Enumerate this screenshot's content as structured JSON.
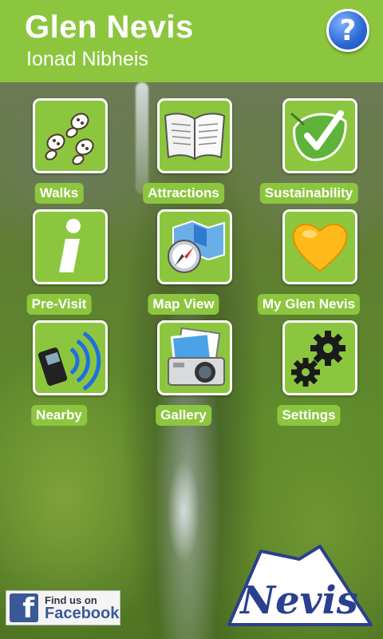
{
  "header": {
    "title": "Glen Nevis",
    "subtitle": "Ionad Nibheis",
    "help_symbol": "?"
  },
  "menu": [
    {
      "label": "Walks",
      "icon": "footprints-icon"
    },
    {
      "label": "Attractions",
      "icon": "book-icon"
    },
    {
      "label": "Sustainability",
      "icon": "leaf-check-icon"
    },
    {
      "label": "Pre-Visit",
      "icon": "info-icon"
    },
    {
      "label": "Map View",
      "icon": "map-compass-icon"
    },
    {
      "label": "My Glen Nevis",
      "icon": "heart-icon"
    },
    {
      "label": "Nearby",
      "icon": "phone-signal-icon"
    },
    {
      "label": "Gallery",
      "icon": "camera-icon"
    },
    {
      "label": "Settings",
      "icon": "gears-icon"
    }
  ],
  "footer": {
    "facebook_line1": "Find us on",
    "facebook_line2": "Facebook",
    "facebook_logo_letter": "f",
    "logo_text": "Nevis"
  },
  "colors": {
    "accent": "#8cc63f",
    "facebook": "#3b5998",
    "nevis_blue": "#2a3f8f"
  }
}
